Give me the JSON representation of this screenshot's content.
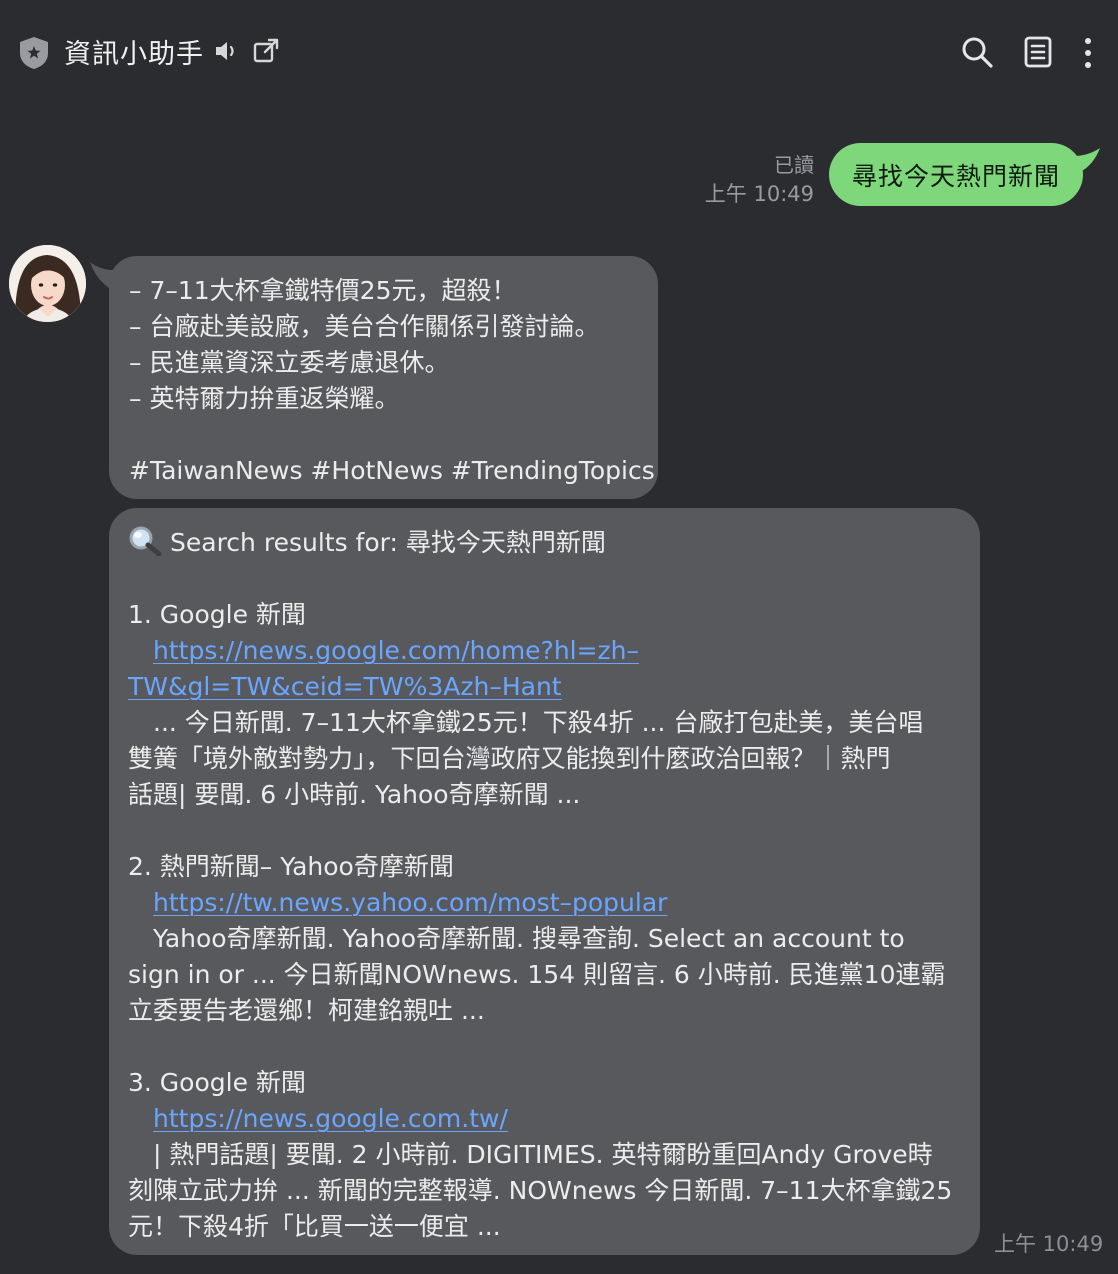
{
  "header": {
    "title": "資訊小助手"
  },
  "outgoing": {
    "read_label": "已讀",
    "time": "上午 10:49",
    "text": "尋找今天熱門新聞"
  },
  "incoming": {
    "bubble1": {
      "lines": [
        "– 7–11大杯拿鐵特價25元，超殺！",
        "– 台廠赴美設廠，美台合作關係引發討論。",
        "– 民進黨資深立委考慮退休。",
        "– 英特爾力拚重返榮耀。"
      ],
      "hashtags": "#TaiwanNews #HotNews #TrendingTopics"
    },
    "bubble2": {
      "header": "Search results for: 尋找今天熱門新聞",
      "results": [
        {
          "title": "1. Google 新聞",
          "url_line1": "https://news.google.com/home?hl=zh–",
          "url_line2": "TW&gl=TW&ceid=TW%3Azh–Hant",
          "snippet_line1": "... 今日新聞. 7–11大杯拿鐵25元！下殺4折 ... 台廠打包赴美，美台唱",
          "snippet_line2": "雙簧「境外敵對勢力」，下回台灣政府又能換到什麼政治回報？｜熱門",
          "snippet_line3": "話題| 要聞. 6 小時前. Yahoo奇摩新聞 ..."
        },
        {
          "title": "2. 熱門新聞– Yahoo奇摩新聞",
          "url_line1": "https://tw.news.yahoo.com/most–popular",
          "snippet_line1": "Yahoo奇摩新聞. Yahoo奇摩新聞. 搜尋查詢. Select an account to",
          "snippet_line2": "sign in or ... 今日新聞NOWnews. 154 則留言. 6 小時前. 民進黨10連霸",
          "snippet_line3": "立委要告老還鄉！柯建銘親吐 ..."
        },
        {
          "title": "3. Google 新聞",
          "url_line1": "https://news.google.com.tw/",
          "snippet_line1": "| 熱門話題| 要聞. 2 小時前. DIGITIMES. 英特爾盼重回Andy Grove時",
          "snippet_line2": "刻陳立武力拚 ... 新聞的完整報導. NOWnews 今日新聞. 7–11大杯拿鐵25",
          "snippet_line3": "元！下殺4折「比買一送一便宜 ..."
        }
      ]
    },
    "time": "上午 10:49"
  },
  "colors": {
    "background": "#2b2c30",
    "incoming_bubble": "#58595d",
    "outgoing_bubble": "#7ed87b",
    "link": "#6aa6ff",
    "meta_text": "#9a9ba0"
  },
  "icons": [
    "shield-icon",
    "mute-icon",
    "external-link-icon",
    "search-icon",
    "notes-icon",
    "more-vertical-icon",
    "magnifier-emoji-icon"
  ]
}
